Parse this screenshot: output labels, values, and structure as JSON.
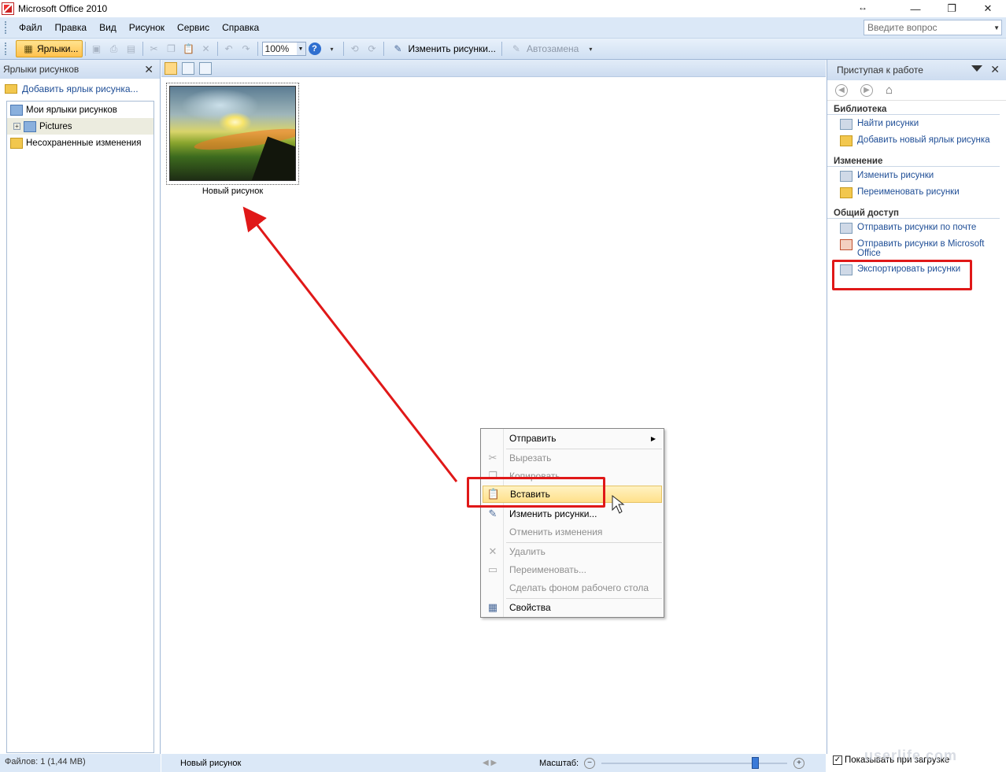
{
  "window": {
    "title": "Microsoft Office 2010",
    "min_label": "—",
    "max_label": "❐",
    "close_label": "✕",
    "resize_label": "↔"
  },
  "menubar": {
    "items": [
      "Файл",
      "Правка",
      "Вид",
      "Рисунок",
      "Сервис",
      "Справка"
    ],
    "ask_placeholder": "Введите вопрос"
  },
  "toolbar": {
    "shortcuts_label": "Ярлыки...",
    "zoom_value": "100%",
    "edit_pictures_label": "Изменить рисунки...",
    "autocorrect_label": "Автозамена"
  },
  "left_pane": {
    "title": "Ярлыки рисунков",
    "add_link": "Добавить ярлык рисунка...",
    "tree": [
      {
        "label": "Мои ярлыки рисунков"
      },
      {
        "label": "Pictures"
      },
      {
        "label": "Несохраненные изменения"
      }
    ]
  },
  "center": {
    "thumbnail_caption": "Новый рисунок"
  },
  "context_menu": {
    "items": [
      {
        "label": "Отправить",
        "enabled": true
      },
      {
        "label": "Вырезать",
        "enabled": false
      },
      {
        "label": "Копировать",
        "enabled": false
      },
      {
        "label": "Вставить",
        "enabled": true,
        "highlighted": true
      },
      {
        "label": "Изменить рисунки...",
        "enabled": true
      },
      {
        "label": "Отменить изменения",
        "enabled": false
      },
      {
        "label": "Удалить",
        "enabled": false
      },
      {
        "label": "Переименовать...",
        "enabled": false
      },
      {
        "label": "Сделать фоном рабочего стола",
        "enabled": false
      },
      {
        "label": "Свойства",
        "enabled": true
      }
    ]
  },
  "right_pane": {
    "title": "Приступая к работе",
    "sections": [
      {
        "title": "Библиотека",
        "links": [
          "Найти рисунки",
          "Добавить новый ярлык рисунка"
        ]
      },
      {
        "title": "Изменение",
        "links": [
          "Изменить рисунки",
          "Переименовать рисунки"
        ]
      },
      {
        "title": "Общий доступ",
        "links": [
          "Отправить рисунки по почте",
          "Отправить рисунки в Microsoft Office",
          "Экспортировать рисунки"
        ]
      }
    ],
    "show_on_start": "Показывать при загрузке"
  },
  "status": {
    "files": "Файлов: 1 (1,44 МВ)",
    "selected": "Новый рисунок",
    "scale_label": "Масштаб:",
    "zoom_level": 0.83
  },
  "watermark": "userlife.com",
  "colors": {
    "annotation_red": "#e01818",
    "link_blue": "#1f4e96",
    "chrome_blue": "#dbe8f7"
  }
}
